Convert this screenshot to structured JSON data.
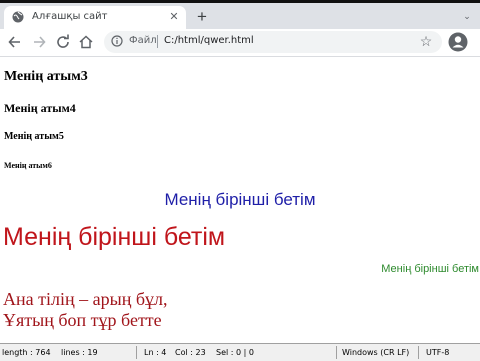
{
  "browser": {
    "tab_title": "Алғашқы сайт",
    "tab_close": "✕",
    "new_tab": "+",
    "tab_menu": "⌄",
    "scheme_label": "Файл",
    "url": "C:/html/qwer.html",
    "icons": {
      "back": "arrow-left-icon",
      "forward": "arrow-right-icon",
      "reload": "reload-icon",
      "home": "home-icon",
      "info": "info-icon",
      "star": "star-icon",
      "profile": "profile-icon"
    }
  },
  "page": {
    "h3": "Менің атым3",
    "h4": "Менің атым4",
    "h5": "Менің атым5",
    "h6": "Менің атым6",
    "center_text": "Менің бірінші бетім",
    "big_text": "Менің бірінші бетім",
    "right_text": "Менің бірінші бетім",
    "poem_line1": "Ана тілің – арың бұл,",
    "poem_line2": "Ұятың боп тұр бетте",
    "colors": {
      "center_text": "#1f1fa8",
      "big_text": "#c0151b",
      "right_text": "#2d8a2d",
      "poem": "#a0141a"
    }
  },
  "statusbar": {
    "length": "length : 764",
    "lines": "lines : 19",
    "ln": "Ln : 4",
    "col": "Col : 23",
    "sel": "Sel : 0 | 0",
    "eol": "Windows (CR LF)",
    "encoding": "UTF-8"
  }
}
